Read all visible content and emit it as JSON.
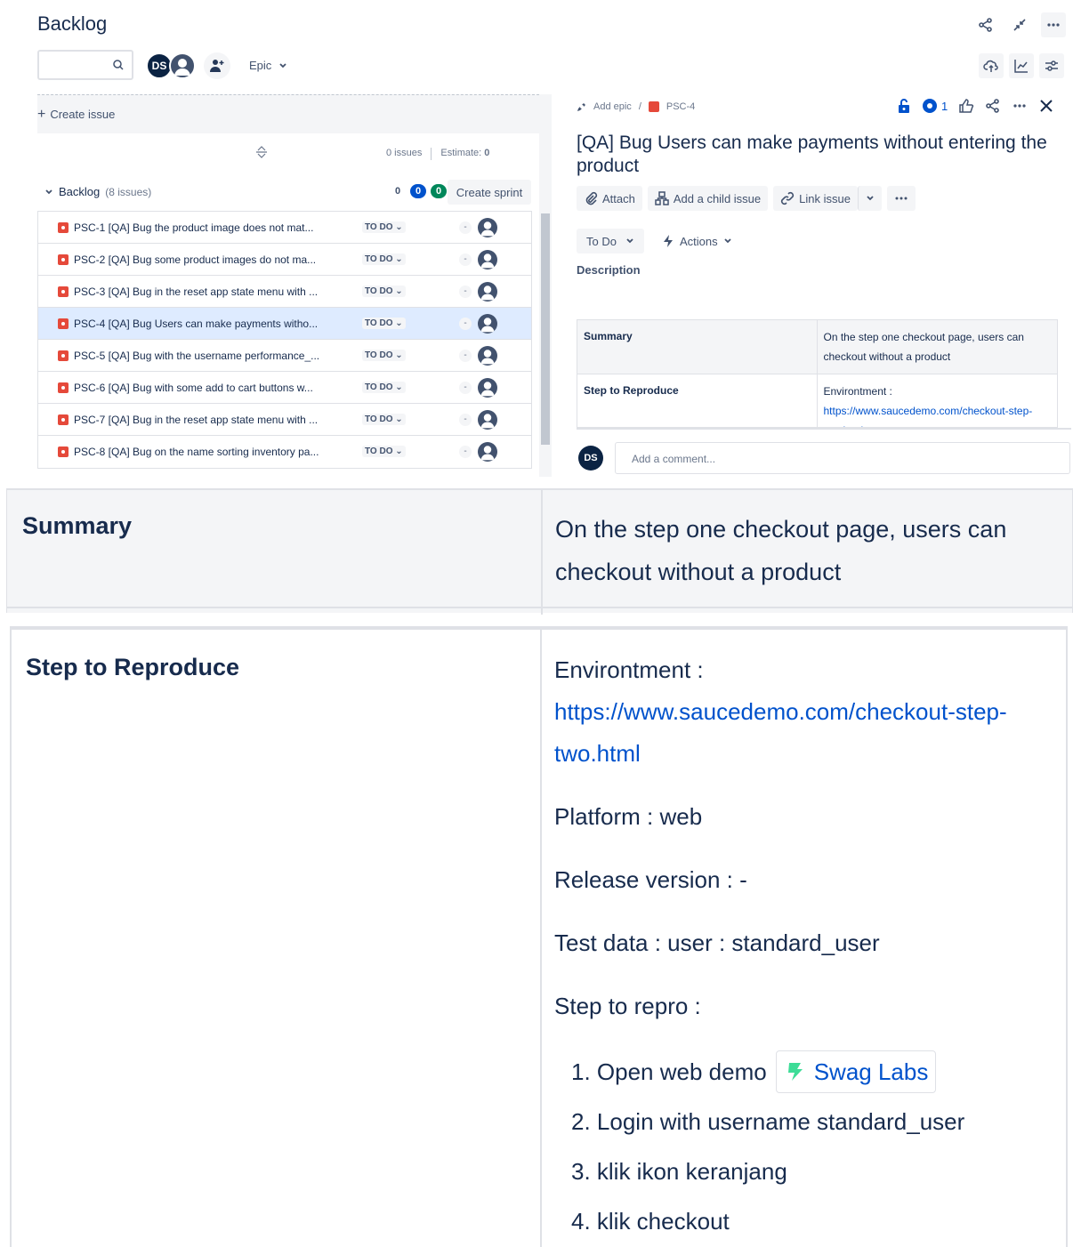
{
  "header": {
    "title": "Backlog",
    "epic_label": "Epic",
    "avatar_initials": "DS"
  },
  "left": {
    "create_issue": "Create issue",
    "issues_count": "0 issues",
    "estimate_label": "Estimate:",
    "estimate_value": "0",
    "backlog_label": "Backlog",
    "backlog_count": "(8 issues)",
    "count_grey": "0",
    "count_blue": "0",
    "count_green": "0",
    "create_sprint": "Create sprint",
    "issues": [
      {
        "text": "PSC-1 [QA] Bug the product image does not mat...",
        "status": "TO DO",
        "estimate": "-"
      },
      {
        "text": "PSC-2 [QA] Bug some product images do not ma...",
        "status": "TO DO",
        "estimate": "-"
      },
      {
        "text": "PSC-3 [QA] Bug in the reset app state menu with ...",
        "status": "TO DO",
        "estimate": "-"
      },
      {
        "text": "PSC-4 [QA] Bug Users can make payments witho...",
        "status": "TO DO",
        "estimate": "-"
      },
      {
        "text": "PSC-5 [QA] Bug with the username performance_...",
        "status": "TO DO",
        "estimate": "-"
      },
      {
        "text": "PSC-6 [QA] Bug with some add to cart buttons w...",
        "status": "TO DO",
        "estimate": "-"
      },
      {
        "text": "PSC-7 [QA] Bug in the reset app state menu with ...",
        "status": "TO DO",
        "estimate": "-"
      },
      {
        "text": "PSC-8 [QA] Bug on the name sorting inventory pa...",
        "status": "TO DO",
        "estimate": "-"
      }
    ]
  },
  "detail": {
    "add_epic": "Add epic",
    "crumb_sep": "/",
    "issue_key": "PSC-4",
    "watch_count": "1",
    "title": "[QA] Bug Users can make payments without entering the product",
    "btn_attach": "Attach",
    "btn_child": "Add a child issue",
    "btn_link": "Link issue",
    "status": "To Do",
    "actions": "Actions",
    "description_label": "Description",
    "table": {
      "summary_label": "Summary",
      "summary_value": "On the step one checkout page, users can checkout without a product",
      "step_label": "Step to Reproduce",
      "env_label": "Environtment :",
      "env_link": "https://www.saucedemo.com/checkout-step-two.html"
    },
    "comment_placeholder": "Add a comment..."
  },
  "zoom": {
    "summary_label": "Summary",
    "summary_value": "On the step one checkout page, users can checkout without a product",
    "step_label": "Step to Reproduce",
    "env_label": "Environtment :",
    "env_link_a": "https://www.saucedemo.com/checkout-step-",
    "env_link_b": "two.html",
    "platform": "Platform : web",
    "release": "Release version : -",
    "test_data": "Test data : user : standard_user",
    "step_repro": "Step to repro :",
    "steps": [
      "1. Open web demo",
      "2. Login with username standard_user",
      "3. klik ikon keranjang",
      "4. klik checkout"
    ],
    "chip_label": "Swag Labs"
  },
  "colors": {
    "brand_blue": "#0052cc",
    "bug_red": "#e5493a",
    "text_dark": "#172b4d",
    "chip_green": "#3ddc97"
  }
}
